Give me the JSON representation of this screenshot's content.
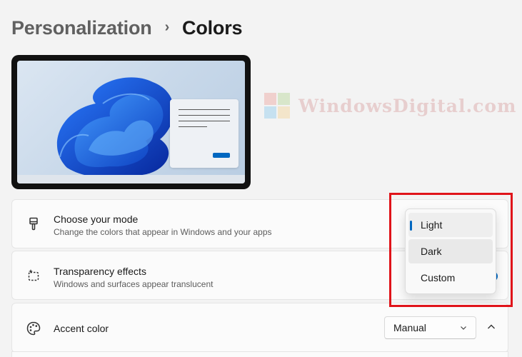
{
  "breadcrumb": {
    "parent": "Personalization",
    "separator": "›",
    "current": "Colors"
  },
  "watermark": {
    "text": "WindowsDigital.com"
  },
  "settings": {
    "mode": {
      "icon": "paintbrush-icon",
      "title": "Choose your mode",
      "description": "Change the colors that appear in Windows and your apps"
    },
    "transparency": {
      "icon": "transparency-icon",
      "title": "Transparency effects",
      "description": "Windows and surfaces appear translucent",
      "toggle_on": true
    },
    "accent": {
      "icon": "palette-icon",
      "title": "Accent color",
      "selected": "Manual",
      "expanded": true
    }
  },
  "mode_dropdown": {
    "options": [
      "Light",
      "Dark",
      "Custom"
    ],
    "selected": "Light",
    "hovered": "Dark"
  },
  "colors": {
    "accent": "#0067c0",
    "highlight": "#e0141a",
    "background": "#f3f3f3"
  }
}
